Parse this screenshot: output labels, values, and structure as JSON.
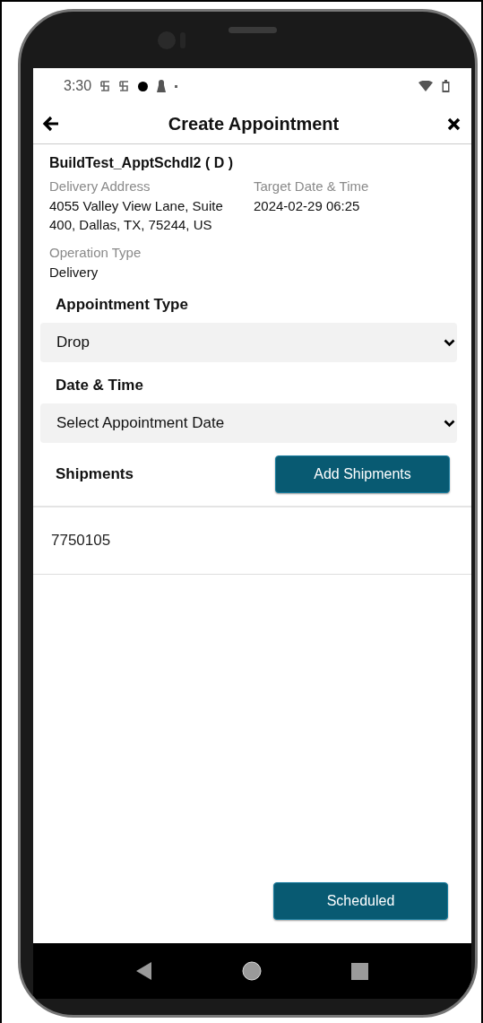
{
  "status_bar": {
    "time": "3:30"
  },
  "header": {
    "title": "Create Appointment"
  },
  "load": {
    "title": "BuildTest_ApptSchdl2 ( D )",
    "fields": [
      {
        "label": "Delivery Address",
        "value": "4055 Valley View Lane, Suite 400, Dallas, TX, 75244, US"
      },
      {
        "label": "Target Date & Time",
        "value": "2024-02-29 06:25"
      },
      {
        "label": "Operation Type",
        "value": "Delivery"
      }
    ]
  },
  "appointment_type": {
    "label": "Appointment Type",
    "value": "Drop"
  },
  "date_time": {
    "label": "Date & Time",
    "placeholder": "Select Appointment Date"
  },
  "shipments": {
    "label": "Shipments",
    "button": "Add Shipments",
    "items": [
      "7750105"
    ]
  },
  "footer_button": "Scheduled"
}
